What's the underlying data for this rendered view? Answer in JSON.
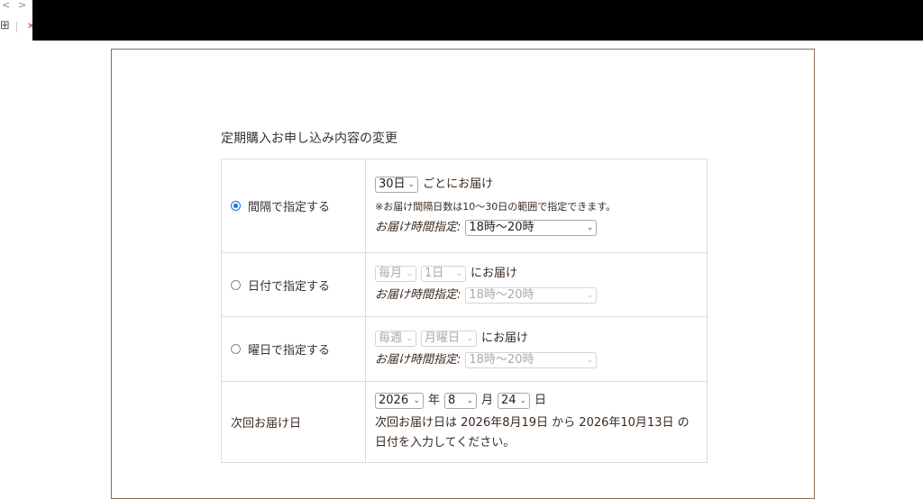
{
  "section_title": "定期購入お申し込み内容の変更",
  "interval": {
    "radio_label": "間隔で指定する",
    "selected": true,
    "days_value": "30日",
    "days_suffix": "ごとにお届け",
    "note": "※お届け間隔日数は10〜30日の範囲で指定できます。",
    "time_label": "お届け時間指定:",
    "time_value": "18時〜20時"
  },
  "by_date": {
    "radio_label": "日付で指定する",
    "selected": false,
    "freq_value": "毎月",
    "day_value": "1日",
    "suffix": "にお届け",
    "time_label": "お届け時間指定:",
    "time_value": "18時〜20時"
  },
  "by_weekday": {
    "radio_label": "曜日で指定する",
    "selected": false,
    "freq_value": "毎週",
    "weekday_value": "月曜日",
    "suffix": "にお届け",
    "time_label": "お届け時間指定:",
    "time_value": "18時〜20時"
  },
  "next_delivery": {
    "label": "次回お届け日",
    "year_value": "2026",
    "year_unit": "年",
    "month_value": "8",
    "month_unit": "月",
    "day_value": "24",
    "day_unit": "日",
    "description": "次回お届け日は 2026年8月19日 から 2026年10月13日 の日付を入力してください。"
  },
  "icons": {
    "chevron": "⌄",
    "back": "<",
    "forward": ">",
    "apps": "⊞"
  },
  "colors": {
    "panel_border": "#8b6b5c",
    "radio_selected": "#1a73e8",
    "text_brown": "#3b2a20"
  }
}
